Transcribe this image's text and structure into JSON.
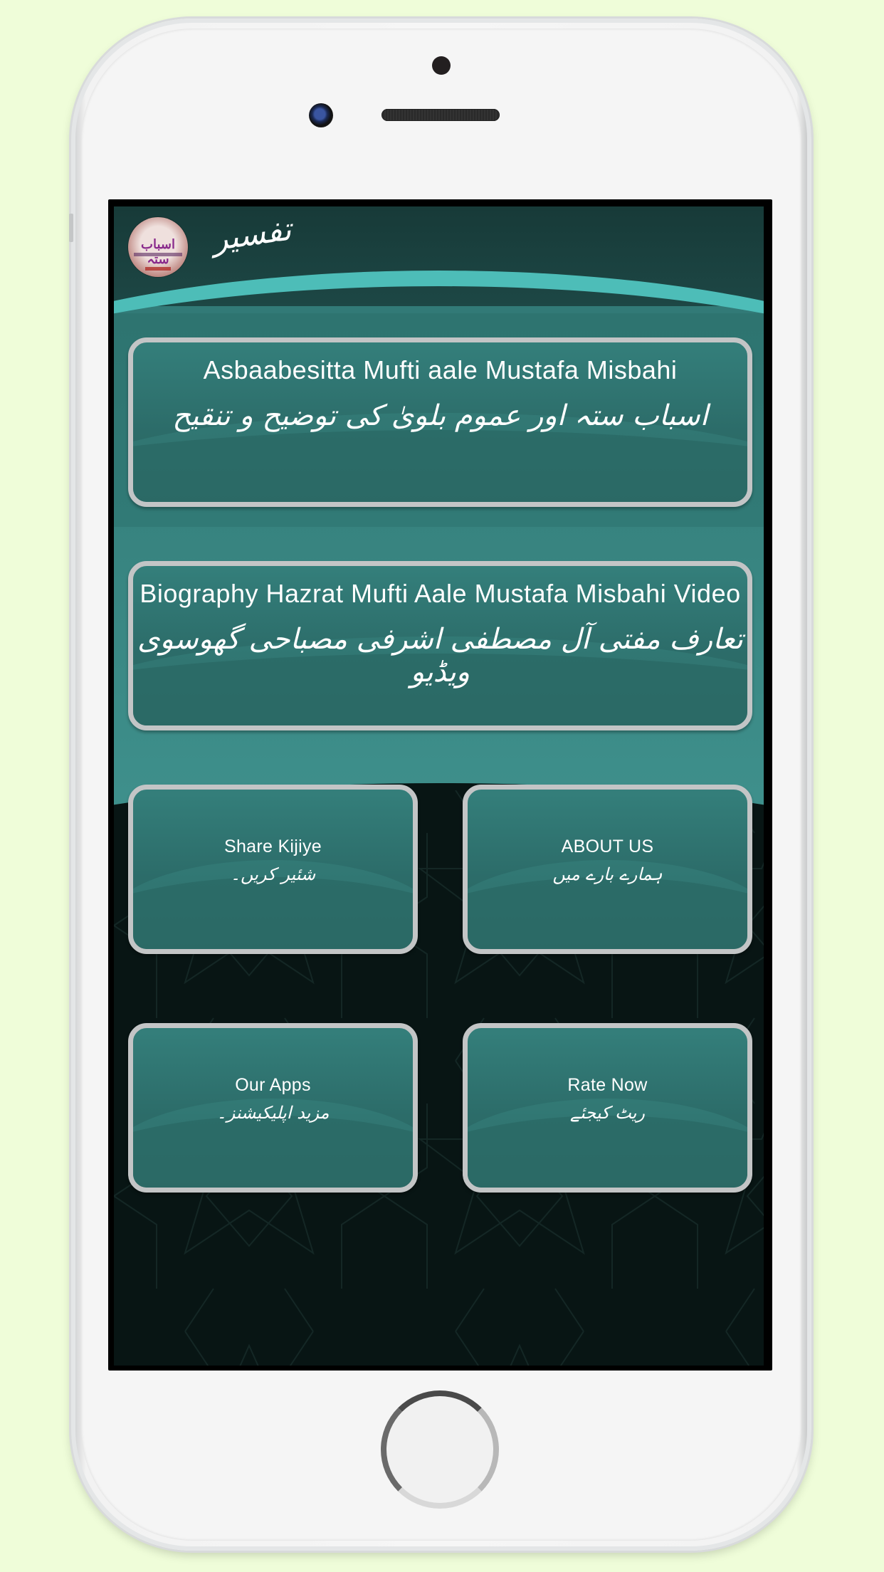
{
  "app": {
    "title": "تفسیر",
    "logo_title": "اسباب ستہ"
  },
  "cards": [
    {
      "en": "Asbaabesitta Mufti aale Mustafa Misbahi",
      "ur": "اسباب ستہ اور عموم بلویٰ کی توضیح و تنقیح"
    },
    {
      "en": "Biography Hazrat Mufti Aale Mustafa Misbahi Video",
      "ur": "تعارف مفتی آل مصطفی اشرفی مصباحی گھوسوی ویڈیو"
    }
  ],
  "tiles": [
    {
      "en": "Share Kijiye",
      "ur": "شئیر کریں۔"
    },
    {
      "en": "ABOUT US",
      "ur": "ہمارے بارے میں"
    },
    {
      "en": "Our Apps",
      "ur": "مزید اپلیکیشنز۔"
    },
    {
      "en": "Rate Now",
      "ur": "ریٹ کیجئے"
    }
  ],
  "colors": {
    "page_background": "#effdd9",
    "header": "#1d4745",
    "accent_arc": "#4dbdb8",
    "card": "#2f7571",
    "card_border": "#c3c5c6",
    "bottom_background": "#081514"
  }
}
